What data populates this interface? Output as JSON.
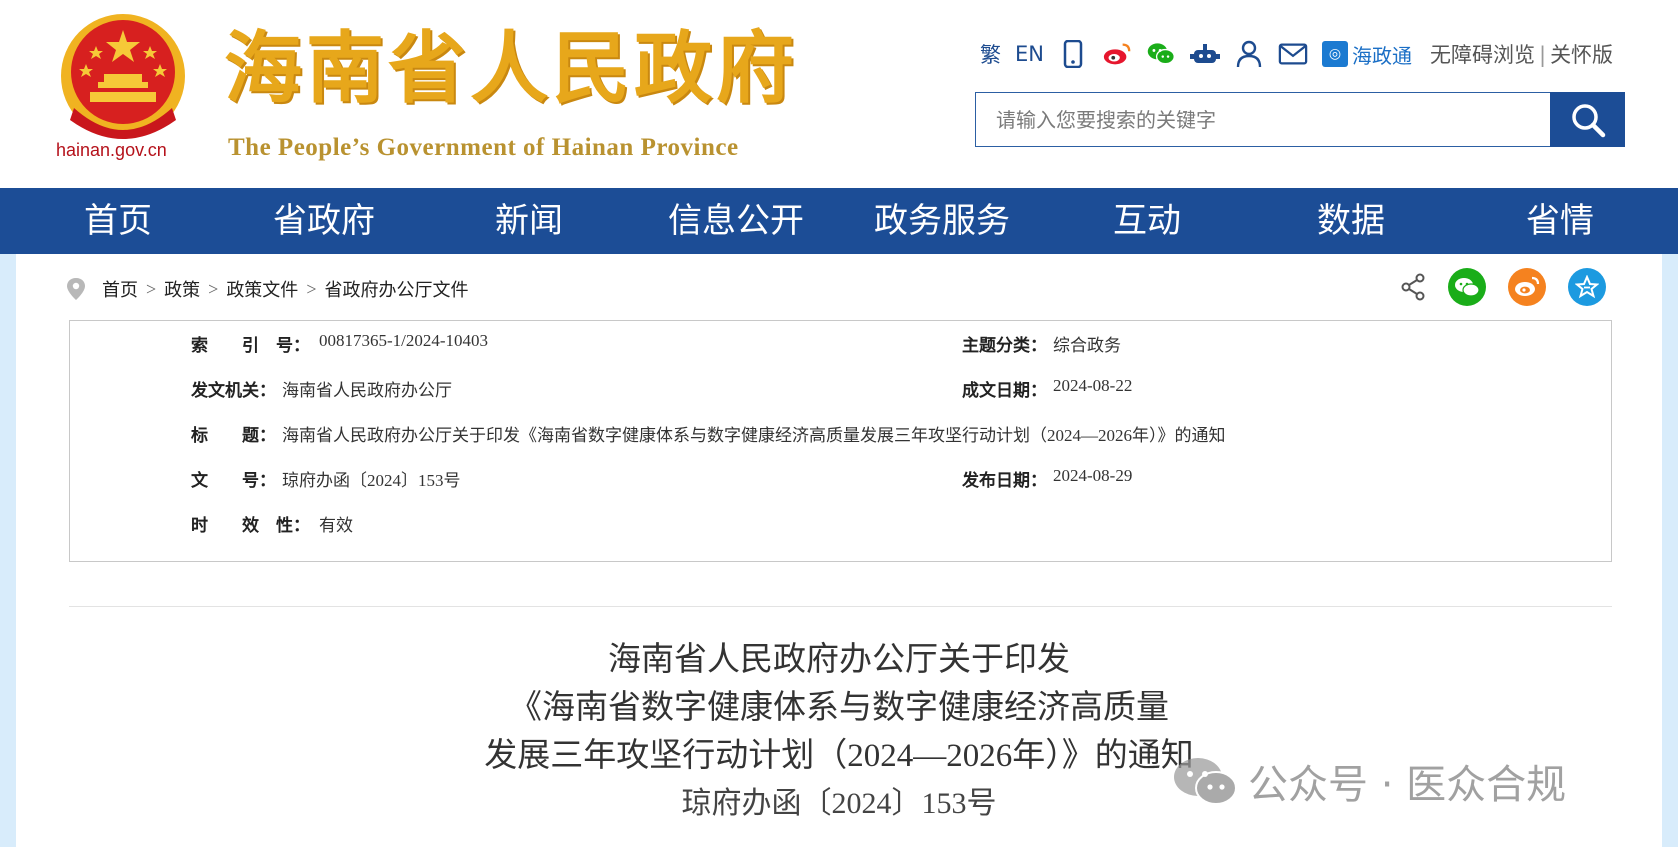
{
  "header": {
    "domain": "hainan.gov.cn",
    "title_cn": "海南省人民政府",
    "title_en": "The People’s Government  of Hainan Province",
    "links": {
      "traditional": "繁",
      "english": "EN",
      "haizhengtong": "海政通",
      "accessible": "无障碍浏览",
      "separator": "|",
      "elder": "关怀版"
    },
    "search": {
      "placeholder": "请输入您要搜索的关键字"
    }
  },
  "nav": {
    "items": [
      "首页",
      "省政府",
      "新闻",
      "信息公开",
      "政务服务",
      "互动",
      "数据",
      "省情"
    ]
  },
  "breadcrumb": {
    "items": [
      "首页",
      "政策",
      "政策文件",
      "省政府办公厅文件"
    ],
    "sep": ">"
  },
  "info": {
    "index_label": "索　　引　号：",
    "index_value": "00817365-1/2024-10403",
    "category_label": "主题分类：",
    "category_value": "综合政务",
    "issuer_label": "发文机关：",
    "issuer_value": "海南省人民政府办公厅",
    "date_written_label": "成文日期：",
    "date_written_value": "2024-08-22",
    "title_label": "标　　题：",
    "title_value": "海南省人民政府办公厅关于印发《海南省数字健康体系与数字健康经济高质量发展三年攻坚行动计划（2024—2026年）》的通知",
    "doc_no_label": "文　　号：",
    "doc_no_value": "琼府办函〔2024〕153号",
    "publish_date_label": "发布日期：",
    "publish_date_value": "2024-08-29",
    "validity_label": "时　　效　性：",
    "validity_value": "有效"
  },
  "article": {
    "title_line1": "海南省人民政府办公厅关于印发",
    "title_line2": "《海南省数字健康体系与数字健康经济高质量",
    "title_line3": "发展三年攻坚行动计划（2024—2026年）》的通知",
    "doc_number": "琼府办函〔2024〕153号"
  },
  "watermark": {
    "text": "公众号 · 医众合规"
  },
  "colors": {
    "nav_blue": "#1c4d96",
    "brand_gold": "#e7a71b",
    "emblem_red": "#d7201f",
    "wechat_green": "#1aad19",
    "weibo_orange": "#f5821f",
    "favorite_blue": "#1c9ae0"
  }
}
